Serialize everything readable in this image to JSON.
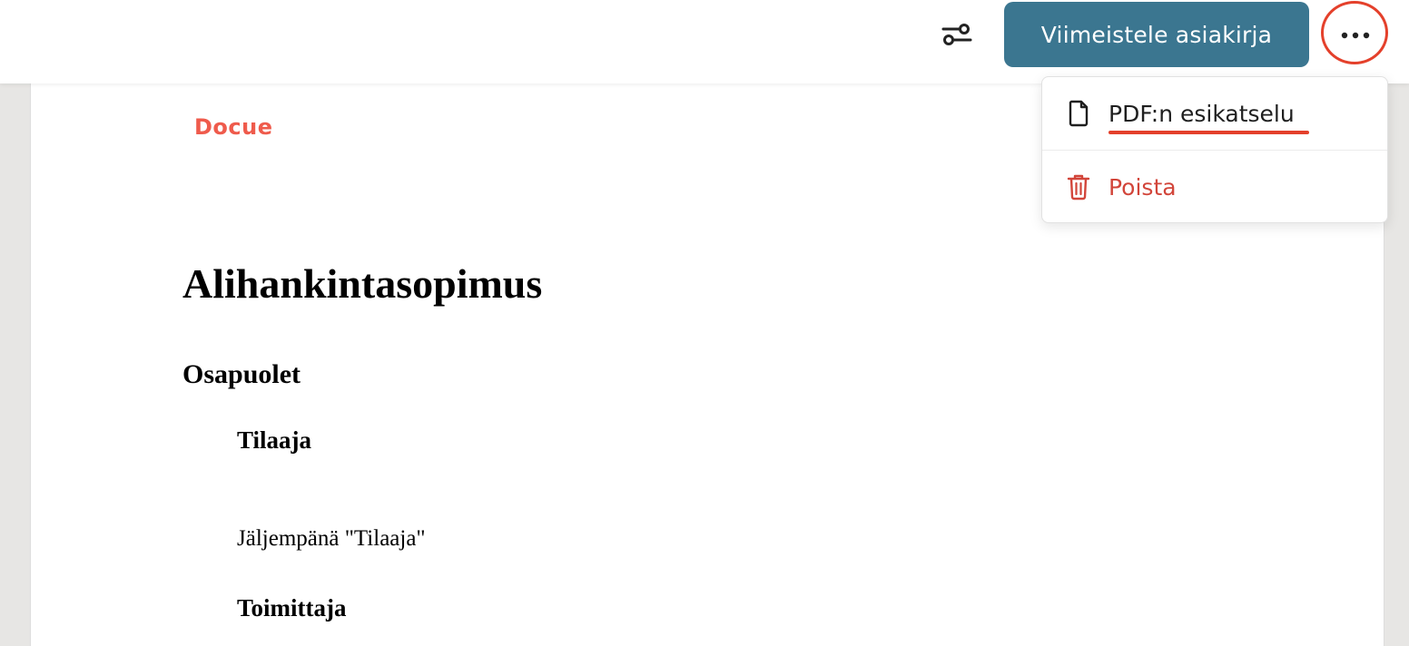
{
  "toolbar": {
    "filter_icon": "sliders-icon",
    "finalize_label": "Viimeistele asiakirja",
    "more_icon": "ellipsis-icon",
    "accent_color": "#3b7690",
    "highlight_color": "#e4402b"
  },
  "menu": {
    "items": [
      {
        "label": "PDF:n esikatselu",
        "icon": "file-icon",
        "color": "#1f1f1f"
      },
      {
        "label": "Poista",
        "icon": "trash-icon",
        "color": "#d2453a"
      }
    ]
  },
  "document": {
    "logo": "Docue",
    "title": "Alihankintasopimus",
    "section": "Osapuolet",
    "parties": [
      {
        "label": "Tilaaja",
        "note": "Jäljempänä \"Tilaaja\""
      },
      {
        "label": "Toimittaja"
      }
    ]
  }
}
